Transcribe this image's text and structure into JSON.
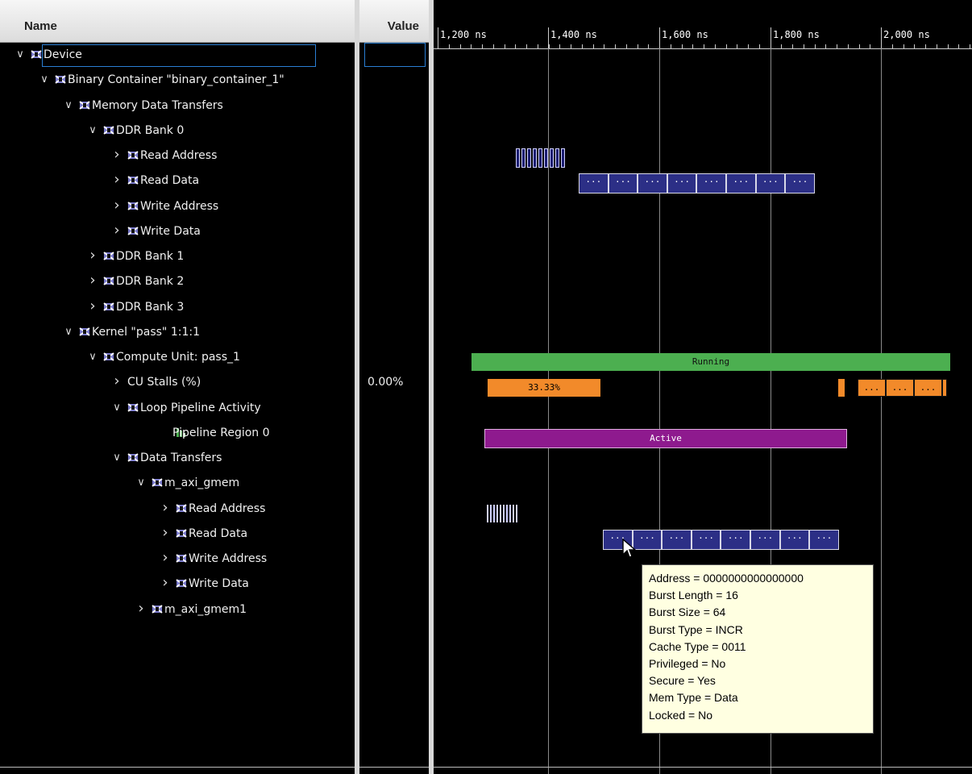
{
  "headers": {
    "name": "Name",
    "value": "Value"
  },
  "tree": [
    {
      "label": "Device",
      "depth": 0,
      "state": "open",
      "icon": "signal-group-icon",
      "value": ""
    },
    {
      "label": "Binary Container \"binary_container_1\"",
      "depth": 1,
      "state": "open",
      "icon": "signal-group-icon",
      "value": ""
    },
    {
      "label": "Memory Data Transfers",
      "depth": 2,
      "state": "open",
      "icon": "signal-group-icon",
      "value": ""
    },
    {
      "label": "DDR Bank 0",
      "depth": 3,
      "state": "open",
      "icon": "signal-group-icon",
      "value": ""
    },
    {
      "label": "Read Address",
      "depth": 4,
      "state": "closed",
      "icon": "signal-group-icon",
      "value": ""
    },
    {
      "label": "Read Data",
      "depth": 4,
      "state": "closed",
      "icon": "signal-group-icon",
      "value": ""
    },
    {
      "label": "Write Address",
      "depth": 4,
      "state": "closed",
      "icon": "signal-group-icon",
      "value": ""
    },
    {
      "label": "Write Data",
      "depth": 4,
      "state": "closed",
      "icon": "signal-group-icon",
      "value": ""
    },
    {
      "label": "DDR Bank 1",
      "depth": 3,
      "state": "closed",
      "icon": "signal-group-icon",
      "value": ""
    },
    {
      "label": "DDR Bank 2",
      "depth": 3,
      "state": "closed",
      "icon": "signal-group-icon",
      "value": ""
    },
    {
      "label": "DDR Bank 3",
      "depth": 3,
      "state": "closed",
      "icon": "signal-group-icon",
      "value": ""
    },
    {
      "label": "Kernel \"pass\" 1:1:1",
      "depth": 2,
      "state": "open",
      "icon": "signal-group-icon",
      "value": ""
    },
    {
      "label": "Compute Unit: pass_1",
      "depth": 3,
      "state": "open",
      "icon": "signal-group-icon",
      "value": ""
    },
    {
      "label": "CU Stalls (%)",
      "depth": 4,
      "state": "closed",
      "icon": "",
      "value": "0.00%"
    },
    {
      "label": "Loop Pipeline Activity",
      "depth": 4,
      "state": "open",
      "icon": "signal-group-icon",
      "value": ""
    },
    {
      "label": "Pipeline Region 0",
      "depth": 6,
      "state": "leaf",
      "icon": "pipeline-signal-icon",
      "value": ""
    },
    {
      "label": "Data Transfers",
      "depth": 4,
      "state": "open",
      "icon": "signal-group-icon",
      "value": ""
    },
    {
      "label": "m_axi_gmem",
      "depth": 5,
      "state": "open",
      "icon": "signal-group-icon",
      "value": ""
    },
    {
      "label": "Read Address",
      "depth": 6,
      "state": "closed",
      "icon": "signal-group-icon",
      "value": ""
    },
    {
      "label": "Read Data",
      "depth": 6,
      "state": "closed",
      "icon": "signal-group-icon",
      "value": ""
    },
    {
      "label": "Write Address",
      "depth": 6,
      "state": "closed",
      "icon": "signal-group-icon",
      "value": ""
    },
    {
      "label": "Write Data",
      "depth": 6,
      "state": "closed",
      "icon": "signal-group-icon",
      "value": ""
    },
    {
      "label": "m_axi_gmem1",
      "depth": 5,
      "state": "closed",
      "icon": "signal-group-icon",
      "value": ""
    }
  ],
  "timeline": {
    "ticks": [
      "1,200 ns",
      "1,400 ns",
      "1,600 ns",
      "1,800 ns",
      "2,000 ns"
    ],
    "bar_running": "Running",
    "bar_active": "Active",
    "stall_label": "33.33%",
    "segment_label": "...",
    "colors": {
      "running": "#4caf50",
      "stall": "#f28a2a",
      "active": "#8e1a8e",
      "transfer": "#2c2f86"
    }
  },
  "tooltip": [
    "Address = 0000000000000000",
    "Burst Length = 16",
    "Burst Size = 64",
    "Burst Type = INCR",
    "Cache Type = 0011",
    "Privileged = No",
    "Secure = Yes",
    "Mem Type = Data",
    "Locked = No"
  ]
}
